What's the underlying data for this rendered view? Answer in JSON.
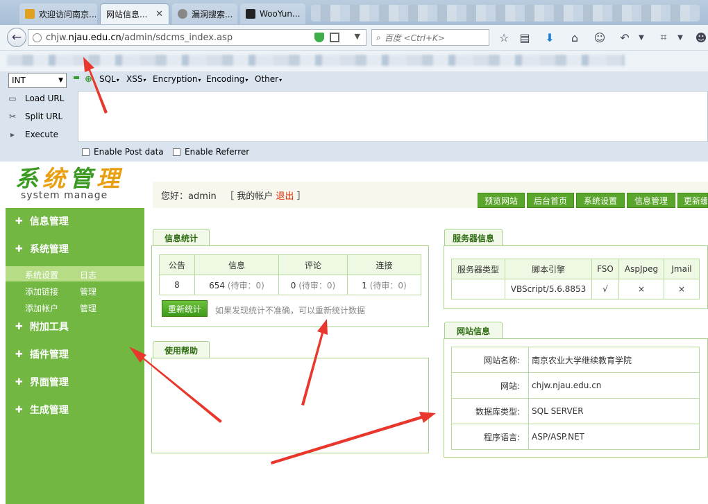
{
  "browser": {
    "tabs": [
      {
        "label": "欢迎访问南京...",
        "active": false,
        "favicon_color": "#e0a020"
      },
      {
        "label": "网站信息...",
        "active": true,
        "favicon_color": "#ffffff"
      },
      {
        "label": "漏洞搜索...",
        "active": false,
        "favicon_color": "#888888"
      },
      {
        "label": "WooYun...",
        "active": false,
        "favicon_color": "#222222"
      }
    ],
    "url_prefix": "chjw.",
    "url_domain": "njau.edu.cn",
    "url_path": "/admin/sdcms_index.asp",
    "search_placeholder": "百度 <Ctrl+K>"
  },
  "hackbar": {
    "select_value": "INT",
    "menus": [
      "SQL",
      "XSS",
      "Encryption",
      "Encoding",
      "Other"
    ],
    "actions": [
      {
        "label": "Load URL",
        "icon": "load-url-icon"
      },
      {
        "label": "Split URL",
        "icon": "split-url-icon"
      },
      {
        "label": "Execute",
        "icon": "execute-icon"
      }
    ],
    "post_label": "Enable Post data",
    "referrer_label": "Enable Referrer"
  },
  "cms": {
    "logo_cn": "系统管理",
    "logo_en": "system manage",
    "hello_prefix": "您好：",
    "username": "admin",
    "account_prefix": "［ 我的帐户",
    "logout": "退出",
    "account_suffix": "］",
    "top_tabs": [
      "预览网站",
      "后台首页",
      "系统设置",
      "信息管理",
      "更新缓"
    ],
    "sidebar": {
      "sections": [
        "信息管理",
        "系统管理",
        "附加工具",
        "插件管理",
        "界面管理",
        "生成管理"
      ],
      "sub_items": [
        {
          "a": "系统设置",
          "b": "日志"
        },
        {
          "a": "添加链接",
          "b": "管理"
        },
        {
          "a": "添加帐户",
          "b": "管理"
        }
      ]
    },
    "stats": {
      "title": "信息统计",
      "headers": [
        "公告",
        "信息",
        "评论",
        "连接"
      ],
      "values": [
        "8",
        "654",
        "0",
        "1"
      ],
      "pending_labels": [
        "",
        "(待审：0)",
        "(待审：0)",
        "(待审：0)"
      ],
      "recount_button": "重新统计",
      "recount_tip": "如果发现统计不准确，可以重新统计数据"
    },
    "help_title": "使用帮助",
    "server": {
      "title": "服务器信息",
      "headers": [
        "服务器类型",
        "脚本引擎",
        "FSO",
        "AspJpeg",
        "Jmail"
      ],
      "values": [
        "",
        "VBScript/5.6.8853",
        "√",
        "×",
        "×"
      ]
    },
    "site": {
      "title": "网站信息",
      "rows": [
        {
          "k": "网站名称:",
          "v": "南京农业大学继续教育学院"
        },
        {
          "k": "网站:",
          "v": "chjw.njau.edu.cn"
        },
        {
          "k": "数据库类型:",
          "v": "SQL SERVER"
        },
        {
          "k": "程序语言:",
          "v": "ASP/ASP.NET"
        }
      ]
    }
  },
  "colors": {
    "sidebar_green": "#71b741",
    "accent_green": "#5aa52b",
    "logout_red": "#d52b00",
    "arrow_red": "#e8382e"
  }
}
